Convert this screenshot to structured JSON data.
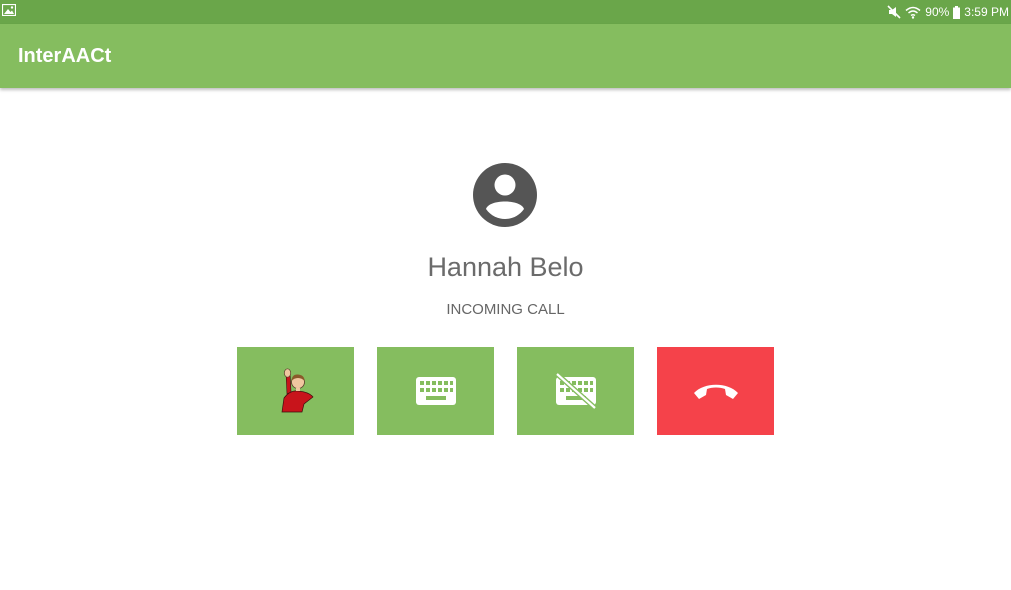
{
  "status_bar": {
    "battery": "90%",
    "time": "3:59 PM",
    "icons": [
      "image-notification-icon",
      "mute-icon",
      "wifi-icon",
      "battery-icon"
    ]
  },
  "app_bar": {
    "title": "InterAACt"
  },
  "call": {
    "caller_name": "Hannah Belo",
    "status": "INCOMING CALL"
  },
  "actions": [
    {
      "name": "wave-greeting-button",
      "icon": "waving-person-icon",
      "color": "#85bd5f"
    },
    {
      "name": "keyboard-button",
      "icon": "keyboard-icon",
      "color": "#85bd5f"
    },
    {
      "name": "keyboard-off-button",
      "icon": "keyboard-off-icon",
      "color": "#85bd5f"
    },
    {
      "name": "end-call-button",
      "icon": "hang-up-icon",
      "color": "#f5424a"
    }
  ],
  "colors": {
    "status_bar": "#6aa64a",
    "app_bar": "#85bd5f",
    "accent_green": "#85bd5f",
    "end_call_red": "#f5424a",
    "avatar_gray": "#555555"
  }
}
